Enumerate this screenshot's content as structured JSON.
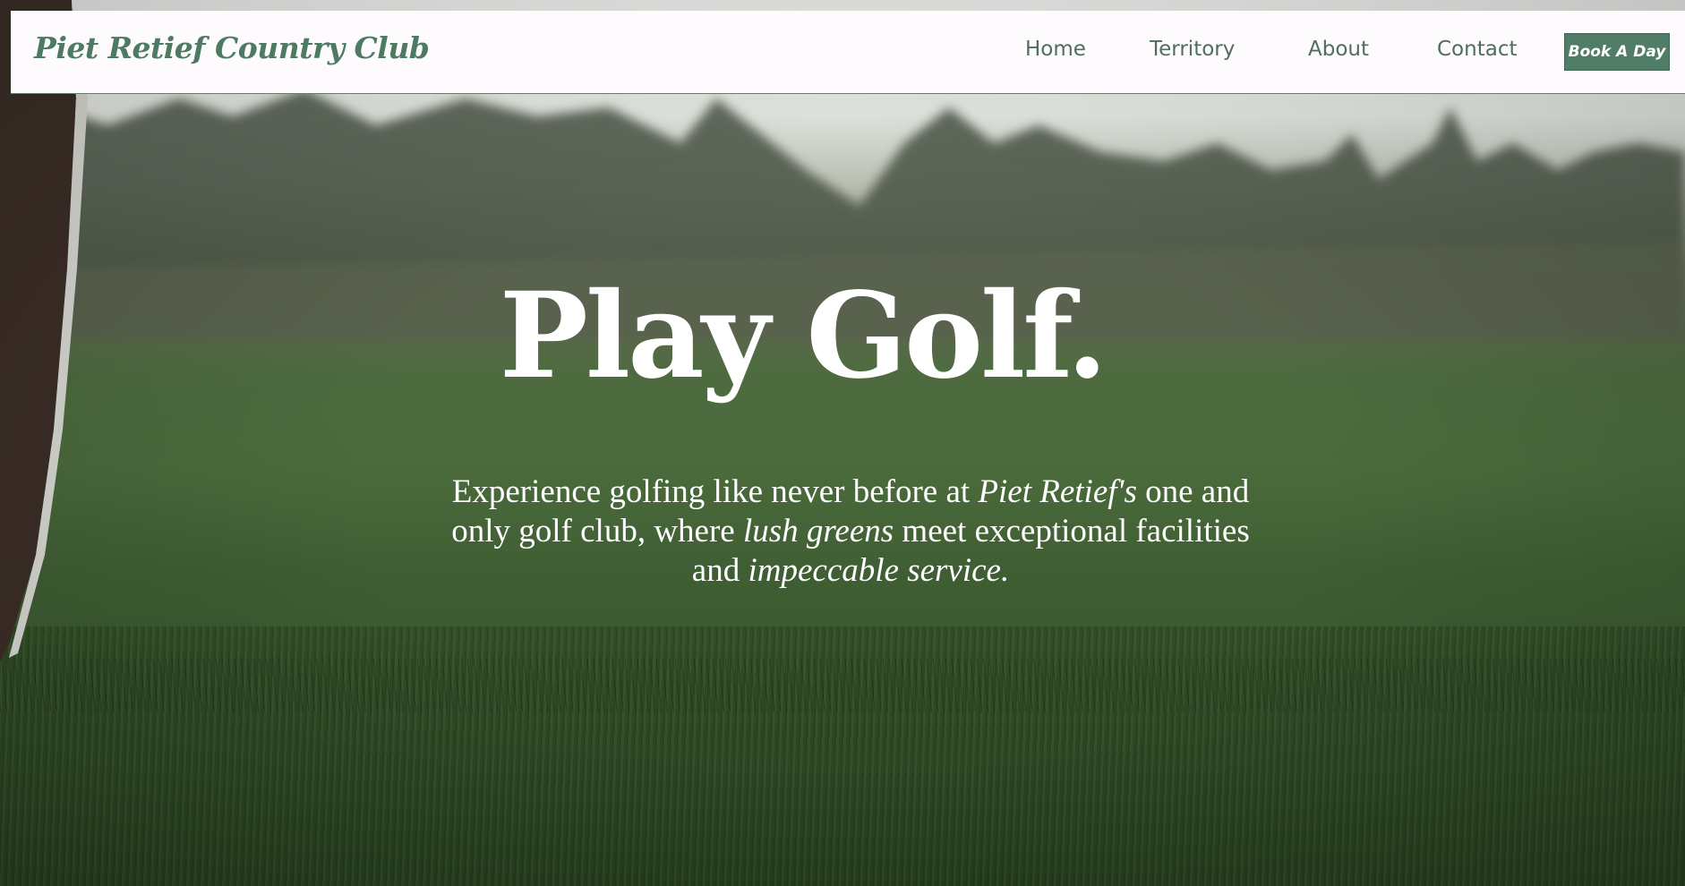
{
  "header": {
    "brand": "Piet Retief Country Club",
    "nav": {
      "home": "Home",
      "territory": "Territory",
      "about": "About",
      "contact": "Contact"
    },
    "cta": "Book A Day"
  },
  "hero": {
    "title": "Play Golf.",
    "copy": {
      "p1": "Experience golfing like never before at ",
      "e1": "Piet Retief's",
      "p2": " one and only golf club, where ",
      "e2": "lush greens",
      "p3": " meet exceptional facilities and ",
      "e3": "impeccable service."
    }
  },
  "colors": {
    "brand_green": "#4d7a63",
    "nav_text": "#4f6d60",
    "cta_bg": "#4f7d67",
    "header_bg": "#fdfbfd"
  }
}
